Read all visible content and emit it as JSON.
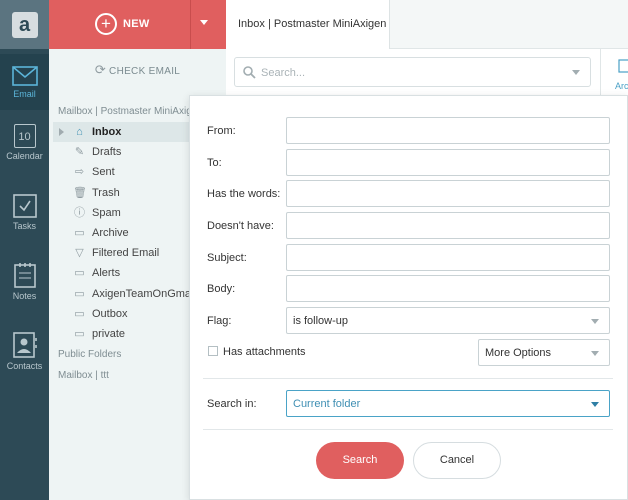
{
  "rail": {
    "email": "Email",
    "calendar": "Calendar",
    "calendar_day": "10",
    "tasks": "Tasks",
    "notes": "Notes",
    "contacts": "Contacts"
  },
  "sidebar": {
    "new_label": "NEW",
    "check_email": "CHECK EMAIL",
    "mailbox_header": "Mailbox | Postmaster MiniAxigen",
    "folders": [
      {
        "label": "Inbox",
        "icon": "inbox-icon"
      },
      {
        "label": "Drafts",
        "icon": "pencil-icon"
      },
      {
        "label": "Sent",
        "icon": "arrow-right-icon"
      },
      {
        "label": "Trash",
        "icon": "trash-icon"
      },
      {
        "label": "Spam",
        "icon": "warning-icon"
      },
      {
        "label": "Archive",
        "icon": "archive-icon"
      },
      {
        "label": "Filtered Email",
        "icon": "filter-icon"
      },
      {
        "label": "Alerts",
        "icon": "folder-icon"
      },
      {
        "label": "AxigenTeamOnGmail",
        "icon": "folder-icon"
      },
      {
        "label": "Outbox",
        "icon": "folder-icon"
      },
      {
        "label": "private",
        "icon": "folder-icon"
      }
    ],
    "public_folders": "Public Folders",
    "mailbox_ttt": "Mailbox | ttt"
  },
  "tab": {
    "title": "Inbox | Postmaster MiniAxigen"
  },
  "search": {
    "placeholder": "Search...",
    "archive_partial": "Arc"
  },
  "form": {
    "from_label": "From:",
    "to_label": "To:",
    "has_words_label": "Has the words:",
    "doesnt_have_label": "Doesn't have:",
    "subject_label": "Subject:",
    "body_label": "Body:",
    "flag_label": "Flag:",
    "flag_value": "is follow-up",
    "has_attachments": "Has attachments",
    "more_options": "More Options",
    "search_in_label": "Search in:",
    "search_in_value": "Current folder",
    "search_button": "Search",
    "cancel_button": "Cancel"
  },
  "colors": {
    "accent_red": "#e05f5f",
    "rail_bg": "#2d4a56",
    "link_blue": "#4aa3c7"
  }
}
